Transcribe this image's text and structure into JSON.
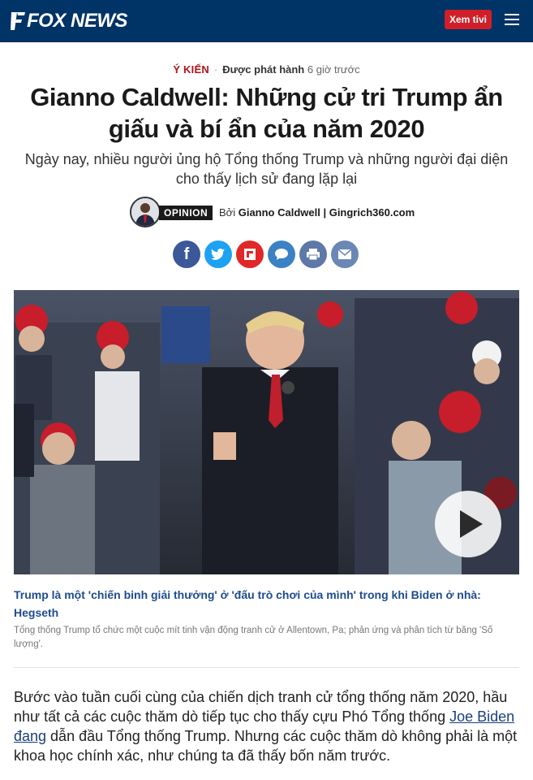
{
  "header": {
    "logo_text": "FOX NEWS",
    "watch_label": "Xem tivi",
    "brand_color": "#003366",
    "accent_color": "#d11f2a"
  },
  "article": {
    "category": "Ý KIẾN",
    "published_label": "Được phát hành",
    "published_time": "6 giờ trước",
    "headline": "Gianno Caldwell: Những cử tri Trump ẩn giấu và bí ẩn của năm 2020",
    "subhead": "Ngày nay, nhiều người ủng hộ Tổng thống Trump và những người đại diện cho thấy lịch sử đang lặp lại",
    "byline": {
      "badge": "OPINION",
      "by": "Bởi",
      "author": "Gianno Caldwell | Gingrich360.com"
    },
    "share_icons": [
      "facebook-icon",
      "twitter-icon",
      "flipboard-icon",
      "comment-icon",
      "print-icon",
      "email-icon"
    ],
    "video": {
      "title": "Trump là một 'chiến binh giải thưởng' ở 'đấu trò chơi của mình' trong khi Biden ở nhà: Hegseth",
      "caption": "Tổng thống Trump tổ chức một cuộc mít tinh vận động tranh cử ở Allentown, Pa; phản ứng và phân tích từ băng 'Số lượng'."
    },
    "body": {
      "part1": "Bước vào tuần cuối cùng của chiến dịch tranh cử tổng thống năm 2020, hầu như tất cả các cuộc thăm dò tiếp tục cho thấy cựu Phó Tổng thống ",
      "link": "Joe Biden đang",
      "part2": " dẫn đầu Tổng thống Trump. Nhưng các cuộc thăm dò không phải là một khoa học chính xác, như chúng ta đã thấy bốn năm trước."
    }
  }
}
